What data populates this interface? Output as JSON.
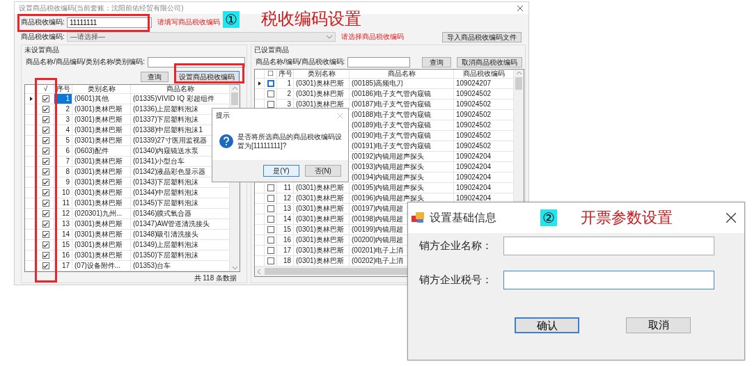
{
  "main_window": {
    "title": "设置商品税收编码(当前套账：沈阳前佑经贸有限公司)",
    "annotation": {
      "marker": "①",
      "text": "税收编码设置"
    },
    "tax_code_input": {
      "label": "商品税收编码:",
      "value": "11111111",
      "hint": "请填写商品税收编码"
    },
    "tax_code_select": {
      "label": "商品税收编码:",
      "value": "—请选择—",
      "hint": "请选择商品税收编码"
    },
    "import_button": "导入商品税收编码文件",
    "unset_group": {
      "title": "未设置商品",
      "search_label": "商品名称/商品编码/类别名称/类别编码:",
      "query_button": "查询",
      "set_button": "设置商品税收编码",
      "columns": [
        "√",
        "序号",
        "类别名称",
        "商品名称"
      ],
      "rows": [
        {
          "selected": true,
          "checked": true,
          "num": "1",
          "category": "(0601)其他",
          "name": "(01335)VIVID IQ 彩超组件"
        },
        {
          "selected": false,
          "checked": true,
          "num": "2",
          "category": "(0301)奥林巴斯",
          "name": "(01336)上层塑料泡沫"
        },
        {
          "selected": false,
          "checked": true,
          "num": "3",
          "category": "(0301)奥林巴斯",
          "name": "(01337)下层塑料泡沫"
        },
        {
          "selected": false,
          "checked": true,
          "num": "4",
          "category": "(0301)奥林巴斯",
          "name": "(01338)中层塑料泡沫1"
        },
        {
          "selected": false,
          "checked": true,
          "num": "5",
          "category": "(0301)奥林巴斯",
          "name": "(01339)27寸医用监视器"
        },
        {
          "selected": false,
          "checked": true,
          "num": "6",
          "category": "(0603)配件",
          "name": "(01340)内窥镜送水泵"
        },
        {
          "selected": false,
          "checked": true,
          "num": "7",
          "category": "(0301)奥林巴斯",
          "name": "(01341)小型台车"
        },
        {
          "selected": false,
          "checked": true,
          "num": "8",
          "category": "(0301)奥林巴斯",
          "name": "(01342)液晶彩色显示器"
        },
        {
          "selected": false,
          "checked": true,
          "num": "9",
          "category": "(0301)奥林巴斯",
          "name": "(01343)下层塑料泡沫"
        },
        {
          "selected": false,
          "checked": true,
          "num": "10",
          "category": "(0301)奥林巴斯",
          "name": "(01344)中层塑料泡沫"
        },
        {
          "selected": false,
          "checked": true,
          "num": "11",
          "category": "(0301)奥林巴斯",
          "name": "(01345)下层塑料泡沫"
        },
        {
          "selected": false,
          "checked": true,
          "num": "12",
          "category": "(020301)九州...",
          "name": "(01346)膜式氧合器"
        },
        {
          "selected": false,
          "checked": true,
          "num": "13",
          "category": "(0301)奥林巴斯",
          "name": "(01347)AW管道清洗接头"
        },
        {
          "selected": false,
          "checked": true,
          "num": "14",
          "category": "(0301)奥林巴斯",
          "name": "(01348)吸引清洗接头"
        },
        {
          "selected": false,
          "checked": true,
          "num": "15",
          "category": "(0301)奥林巴斯",
          "name": "(01349)上层塑料泡沫"
        },
        {
          "selected": false,
          "checked": true,
          "num": "16",
          "category": "(0301)奥林巴斯",
          "name": "(01350)下层塑料泡沫"
        },
        {
          "selected": false,
          "checked": true,
          "num": "17",
          "category": "(07)设备附件...",
          "name": "(01353)台车"
        }
      ],
      "footer": "共 118 条数据"
    },
    "set_group": {
      "title": "已设置商品",
      "search_label": "商品名称/编码/商品税收编码:",
      "query_button": "查询",
      "cancel_button": "取消商品税收编码",
      "columns": [
        "☐",
        "序号",
        "类别名称",
        "商品名称",
        "商品税收编码"
      ],
      "rows": [
        {
          "selected": true,
          "checked": false,
          "num": "1",
          "category": "(0301)奥林巴斯",
          "name": "(00185)高频电刀",
          "code": "109024207"
        },
        {
          "selected": false,
          "checked": false,
          "num": "2",
          "category": "(0301)奥林巴斯",
          "name": "(00186)电子支气管内窥镜",
          "code": "109024502"
        },
        {
          "selected": false,
          "checked": false,
          "num": "3",
          "category": "(0301)奥林巴斯",
          "name": "(00187)电子支气管内窥镜",
          "code": "109024502"
        },
        {
          "name": "(00188)电子支气管内窥镜",
          "code": "109024502"
        },
        {
          "name": "(00189)电子支气管内窥镜",
          "code": "109024502"
        },
        {
          "name": "(00190)电子支气管内窥镜",
          "code": "109024502"
        },
        {
          "name": "(00191)电子支气管内窥镜",
          "code": "109024502"
        },
        {
          "name": "(00192)内镜用超声探头",
          "code": "109024204"
        },
        {
          "name": "(00193)内镜用超声探头",
          "code": "109024204"
        },
        {
          "name": "(00194)内镜用超声探头",
          "code": "109024204"
        },
        {
          "selected": false,
          "checked": false,
          "num": "11",
          "category": "(0301)奥林巴斯",
          "name": "(00195)内镜用超声探头",
          "code": "109024204"
        },
        {
          "selected": false,
          "checked": false,
          "num": "12",
          "category": "(0301)奥林巴斯",
          "name": "(00196)内镜用超声探头",
          "code": "109024204"
        },
        {
          "selected": false,
          "checked": false,
          "num": "13",
          "category": "(0301)奥林巴斯",
          "name": "(00197)内镜用超"
        },
        {
          "selected": false,
          "checked": false,
          "num": "14",
          "category": "(0301)奥林巴斯",
          "name": "(00198)内镜用超"
        },
        {
          "selected": false,
          "checked": false,
          "num": "15",
          "category": "(0301)奥林巴斯",
          "name": "(00199)内镜用超"
        },
        {
          "selected": false,
          "checked": false,
          "num": "16",
          "category": "(0301)奥林巴斯",
          "name": "(00200)内镜用超"
        },
        {
          "selected": false,
          "checked": false,
          "num": "17",
          "category": "(0301)奥林巴斯",
          "name": "(00201)电子上消"
        },
        {
          "selected": false,
          "checked": false,
          "num": "18",
          "category": "(0301)奥林巴斯",
          "name": "(00202)电子上消"
        }
      ]
    }
  },
  "confirm_dialog": {
    "title": "提示",
    "message": "是否将所选商品的商品税收编码设置为[11111111]?",
    "buttons": [
      {
        "label": "是(Y)",
        "focused": true
      },
      {
        "label": "否(N)",
        "focused": false
      }
    ]
  },
  "info_window": {
    "title": "设置基础信息",
    "annotation": {
      "marker": "②",
      "text": "开票参数设置"
    },
    "fields": [
      {
        "label": "销方企业名称：",
        "focused": false
      },
      {
        "label": "销方企业税号：",
        "focused": true
      }
    ],
    "buttons": [
      {
        "label": "确认",
        "focused": true
      },
      {
        "label": "取消",
        "focused": false
      }
    ]
  }
}
